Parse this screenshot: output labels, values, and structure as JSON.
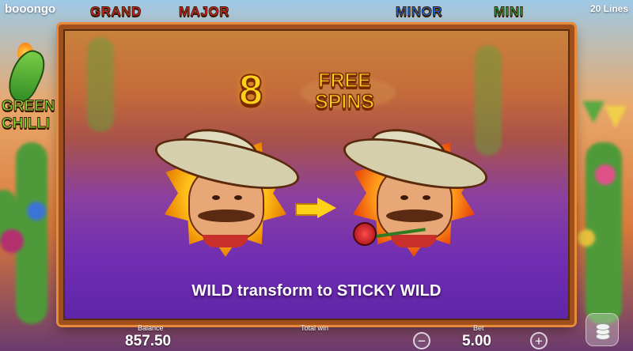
{
  "header": {
    "brand": "booongo",
    "lines": "20 Lines",
    "jackpots": [
      "GRAND",
      "MAJOR",
      "MINOR",
      "MINI"
    ]
  },
  "logo": {
    "word1": "GREEN",
    "word2": "CHILLI"
  },
  "popup": {
    "spin_count": "8",
    "free_line1": "FREE",
    "free_line2": "SPINS",
    "caption": "WILD transform to STICKY WILD",
    "left_symbol": "wild-mariachi-icon",
    "right_symbol": "sticky-wild-mariachi-rose-icon"
  },
  "footer": {
    "balance_label": "Balance",
    "balance_value": "857.50",
    "total_win_label": "Total win",
    "bet_label": "Bet",
    "bet_value": "5.00",
    "minus_label": "−",
    "plus_label": "+"
  },
  "colors": {
    "grand": "#e2262d",
    "major": "#e2262d",
    "minor": "#1e6fe0",
    "mini": "#2aa84a",
    "gold_text": "#ffd21a"
  }
}
